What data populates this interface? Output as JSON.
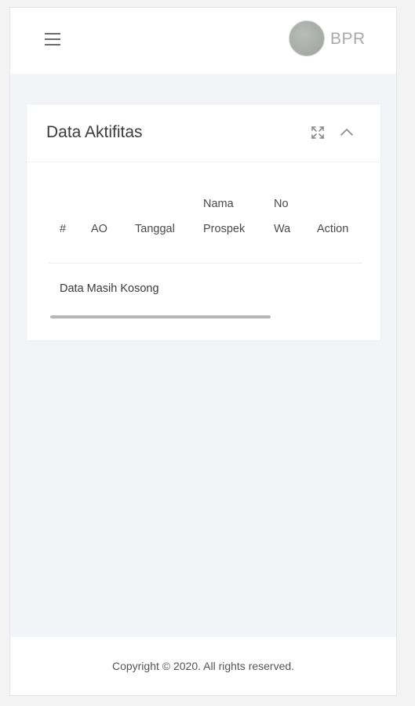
{
  "header": {
    "menu_icon": "hamburger-menu-icon",
    "avatar_icon": "user-avatar",
    "brand": "BPR"
  },
  "card": {
    "title": "Data Aktifitas",
    "expand_icon": "expand-icon",
    "collapse_icon": "chevron-up-icon",
    "table": {
      "columns": [
        {
          "line1": "",
          "line2": "#"
        },
        {
          "line1": "",
          "line2": "AO"
        },
        {
          "line1": "",
          "line2": "Tanggal"
        },
        {
          "line1": "Nama",
          "line2": "Prospek"
        },
        {
          "line1": "No",
          "line2": "Wa"
        },
        {
          "line1": "",
          "line2": "Action"
        }
      ],
      "empty_message": "Data Masih Kosong"
    }
  },
  "footer": {
    "copyright": "Copyright © 2020. All rights reserved."
  },
  "colors": {
    "page_bg": "#f2f4f8",
    "card_bg": "#ffffff",
    "brand_text": "#a9a9a9",
    "scrollbar": "#b6b6b6"
  }
}
